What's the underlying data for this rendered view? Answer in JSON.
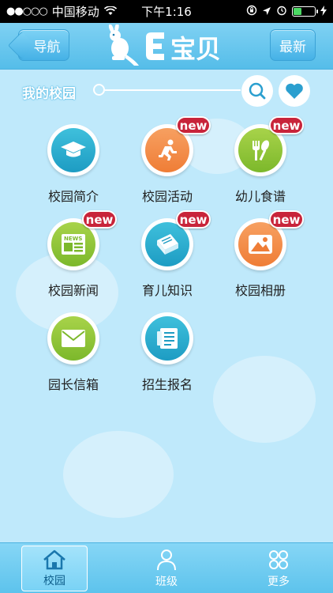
{
  "status_bar": {
    "signal": "●●○○○",
    "carrier": "中国移动",
    "time": "下午1:16"
  },
  "header": {
    "nav_label": "导航",
    "latest_label": "最新",
    "logo_text": "E宝贝"
  },
  "section": {
    "title": "我的校园"
  },
  "grid": {
    "items": [
      {
        "label": "校园简介",
        "badge": ""
      },
      {
        "label": "校园活动",
        "badge": "new"
      },
      {
        "label": "幼儿食谱",
        "badge": "new"
      },
      {
        "label": "校园新闻",
        "badge": "new"
      },
      {
        "label": "育儿知识",
        "badge": "new"
      },
      {
        "label": "校园相册",
        "badge": "new"
      },
      {
        "label": "园长信箱",
        "badge": ""
      },
      {
        "label": "招生报名",
        "badge": ""
      }
    ]
  },
  "tabbar": {
    "tabs": [
      {
        "label": "校园"
      },
      {
        "label": "班级"
      },
      {
        "label": "更多"
      }
    ]
  },
  "colors": {
    "background": "#bfe9fb",
    "header": "#55bde9",
    "badge": "#c8243a",
    "teal": "#1d9cc3",
    "orange": "#ef7d36",
    "green": "#7cb82b"
  }
}
